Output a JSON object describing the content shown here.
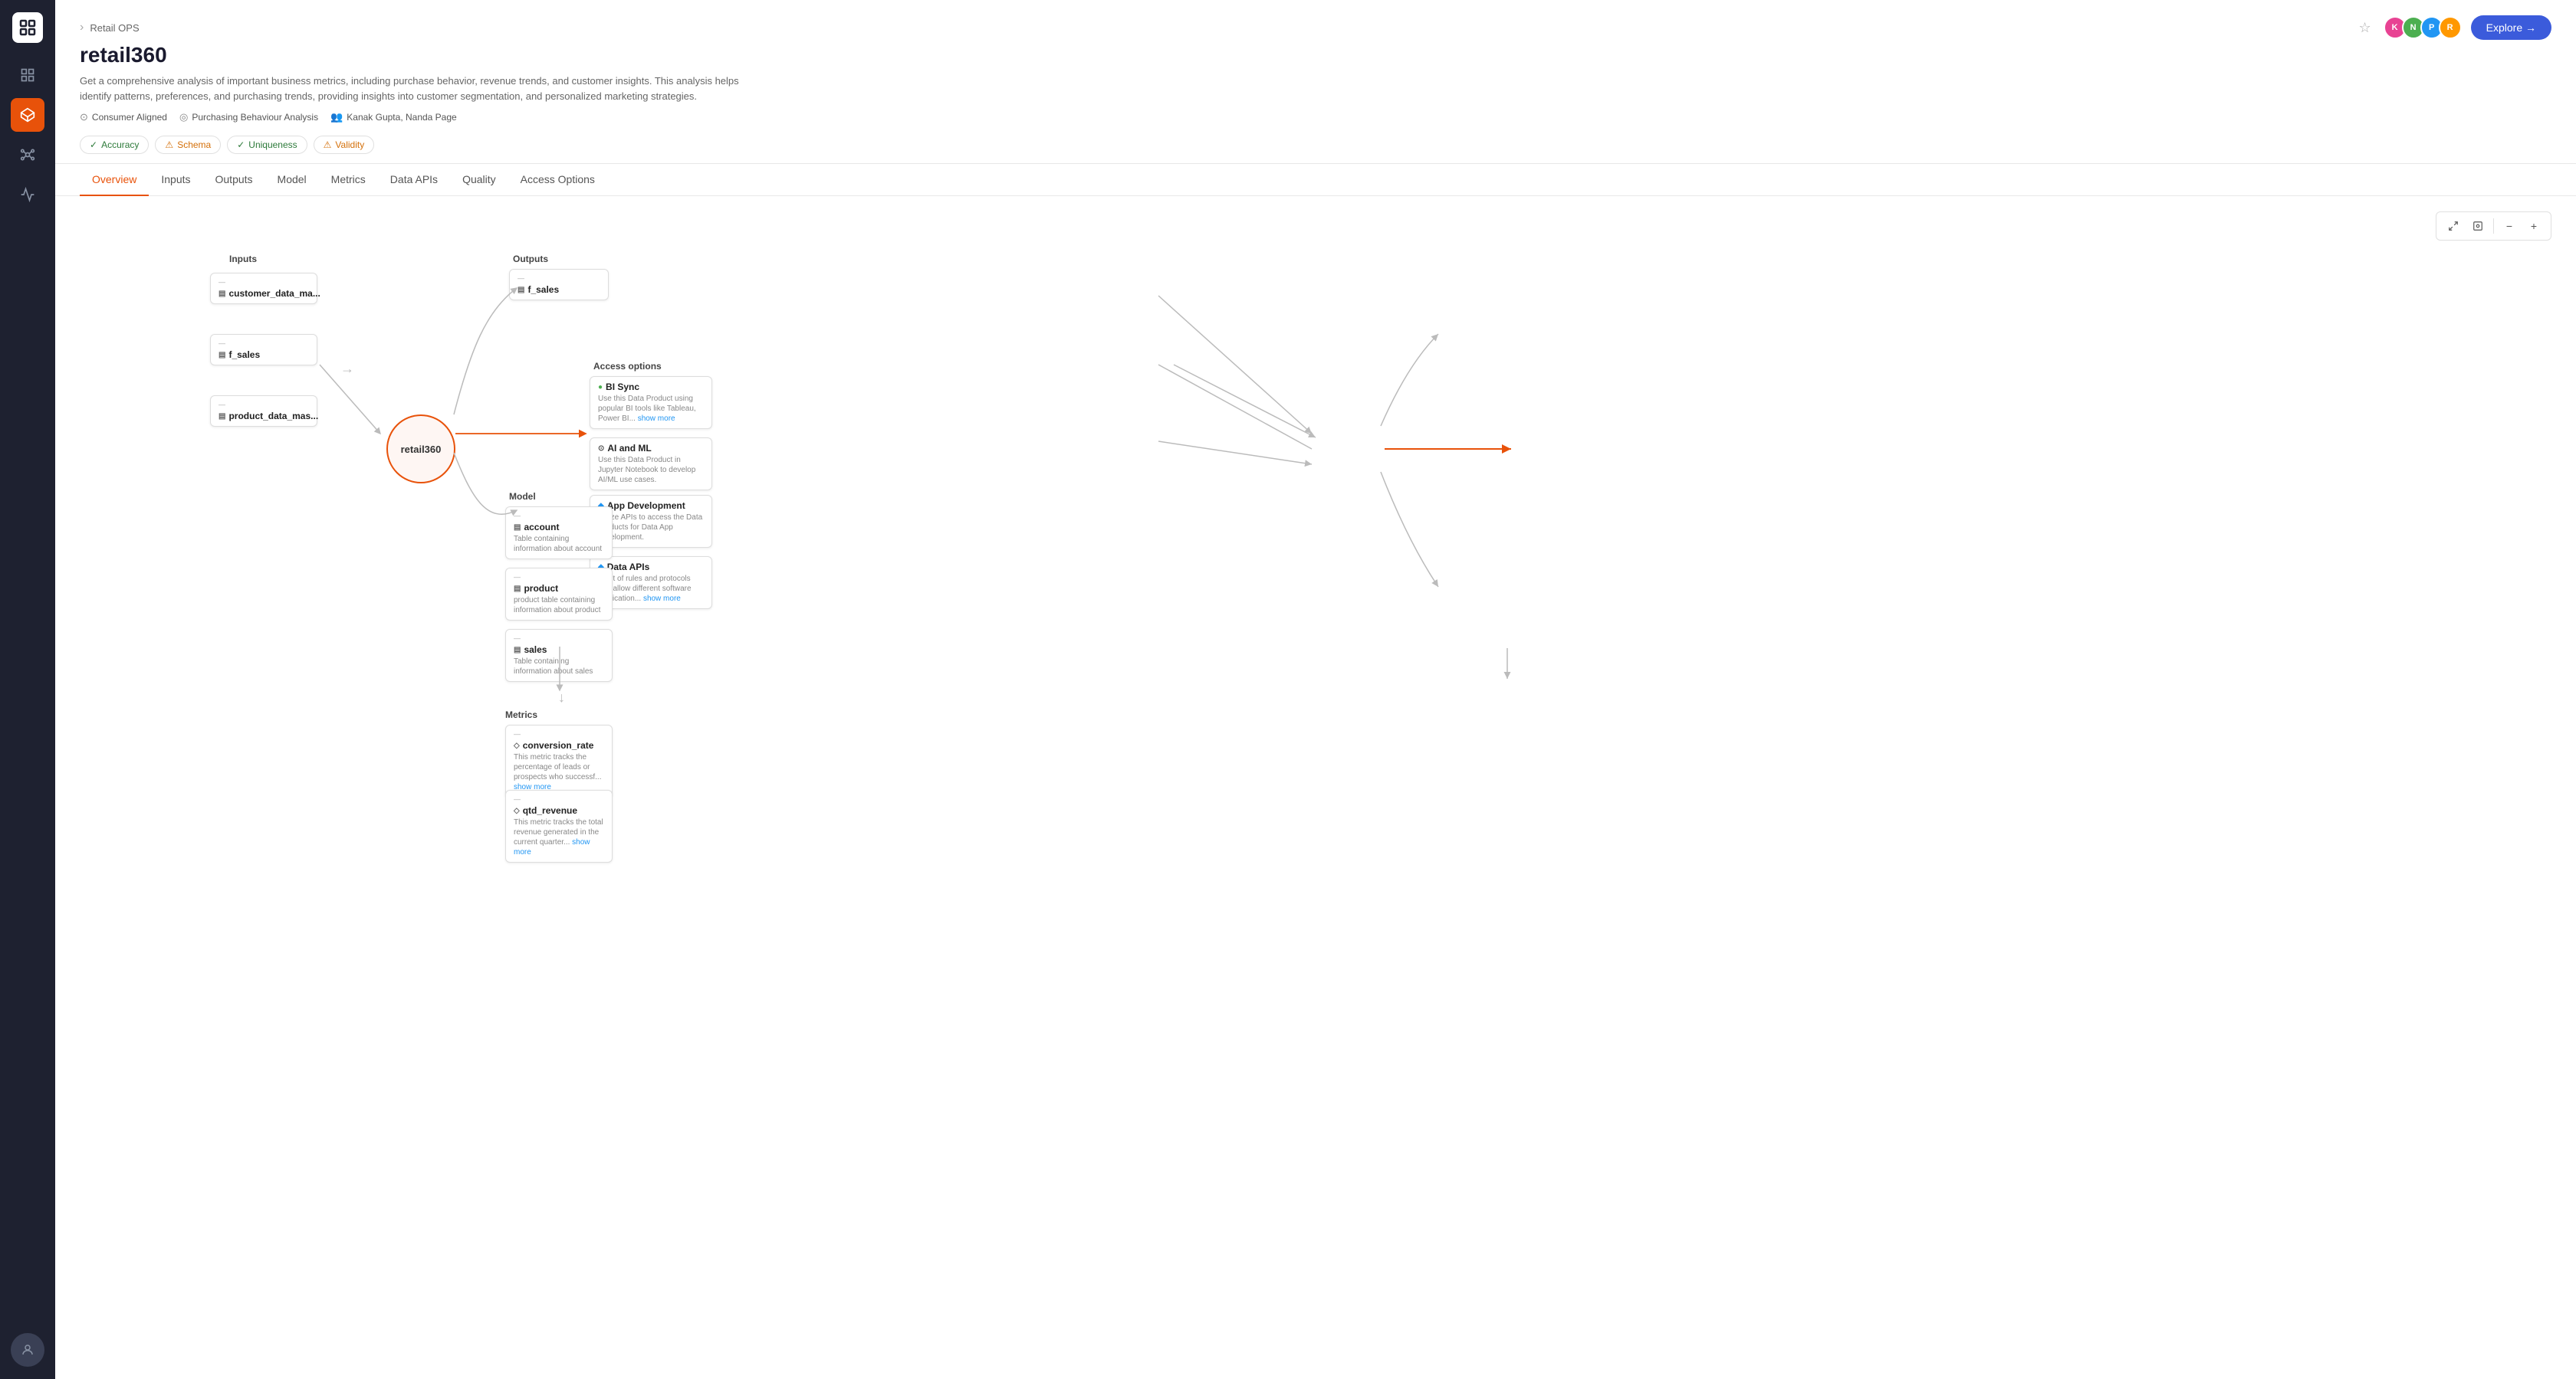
{
  "sidebar": {
    "logo_alt": "Logo",
    "nav_items": [
      {
        "id": "grid",
        "icon": "⊞",
        "active": false
      },
      {
        "id": "data",
        "icon": "◈",
        "active": true
      },
      {
        "id": "nodes",
        "icon": "⬡",
        "active": false
      },
      {
        "id": "activity",
        "icon": "∿",
        "active": false
      }
    ],
    "user_icon": "👤"
  },
  "header": {
    "breadcrumb": "Retail OPS",
    "title": "retail360",
    "description": "Get a comprehensive analysis of important business metrics, including purchase behavior, revenue trends, and customer insights. This analysis helps identify patterns, preferences, and purchasing trends, providing insights into customer segmentation, and personalized marketing strategies.",
    "meta": {
      "domain": "Consumer Aligned",
      "analysis": "Purchasing Behaviour Analysis",
      "owners": "Kanak Gupta, Nanda Page"
    },
    "explore_btn": "Explore →"
  },
  "quality_badges": [
    {
      "label": "Accuracy",
      "type": "green"
    },
    {
      "label": "Schema",
      "type": "orange"
    },
    {
      "label": "Uniqueness",
      "type": "green"
    },
    {
      "label": "Validity",
      "type": "orange"
    }
  ],
  "tabs": [
    {
      "id": "overview",
      "label": "Overview",
      "active": true
    },
    {
      "id": "inputs",
      "label": "Inputs",
      "active": false
    },
    {
      "id": "outputs",
      "label": "Outputs",
      "active": false
    },
    {
      "id": "model",
      "label": "Model",
      "active": false
    },
    {
      "id": "metrics",
      "label": "Metrics",
      "active": false
    },
    {
      "id": "data_apis",
      "label": "Data APIs",
      "active": false
    },
    {
      "id": "quality",
      "label": "Quality",
      "active": false
    },
    {
      "id": "access_options",
      "label": "Access Options",
      "active": false
    }
  ],
  "diagram": {
    "center_node": "retail360",
    "sections": {
      "inputs": {
        "label": "Inputs",
        "nodes": [
          {
            "id": "customer_data_ma",
            "title": "customer_data_ma...",
            "icon": "▤"
          },
          {
            "id": "f_sales_input",
            "title": "f_sales",
            "icon": "▤"
          },
          {
            "id": "product_data_mas",
            "title": "product_data_mas...",
            "icon": "▤"
          }
        ]
      },
      "outputs": {
        "label": "Outputs",
        "nodes": [
          {
            "id": "f_sales_output",
            "title": "f_sales",
            "icon": "▤"
          }
        ]
      },
      "model": {
        "label": "Model",
        "nodes": [
          {
            "id": "account",
            "title": "account",
            "desc": "Table containing information about account",
            "icon": "▤"
          },
          {
            "id": "product",
            "title": "product",
            "desc": "product table containing information about product",
            "icon": "▤"
          },
          {
            "id": "sales",
            "title": "sales",
            "desc": "Table containing information about sales",
            "icon": "▤"
          }
        ]
      },
      "metrics": {
        "label": "Metrics",
        "nodes": [
          {
            "id": "conversion_rate",
            "title": "conversion_rate",
            "desc": "This metric tracks the percentage of leads or prospects who successf... show more",
            "icon": "◇"
          },
          {
            "id": "qtd_revenue",
            "title": "qtd_revenue",
            "desc": "This metric tracks the total revenue generated in the current quarter... show more",
            "icon": "◇"
          }
        ]
      },
      "access_options": {
        "label": "Access options",
        "nodes": [
          {
            "id": "bi_sync",
            "title": "BI Sync",
            "desc": "Use this Data Product using popular BI tools like Tableau, Power BI... show more",
            "color": "#4caf50"
          },
          {
            "id": "ai_and_ml",
            "title": "AI and ML",
            "desc": "Use this Data Product in Jupyter Notebook to develop AI/ML use cases.",
            "color": "#555"
          },
          {
            "id": "app_development",
            "title": "App Development",
            "desc": "Utilize APIs to access the Data Products for Data App development.",
            "color": "#2196f3"
          },
          {
            "id": "data_apis",
            "title": "Data APIs",
            "desc": "A set of rules and protocols that allow different software application... show more",
            "color": "#2196f3"
          }
        ]
      }
    }
  },
  "controls": {
    "fullscreen": "⛶",
    "fit": "⊡",
    "zoom_out": "−",
    "zoom_in": "+"
  }
}
